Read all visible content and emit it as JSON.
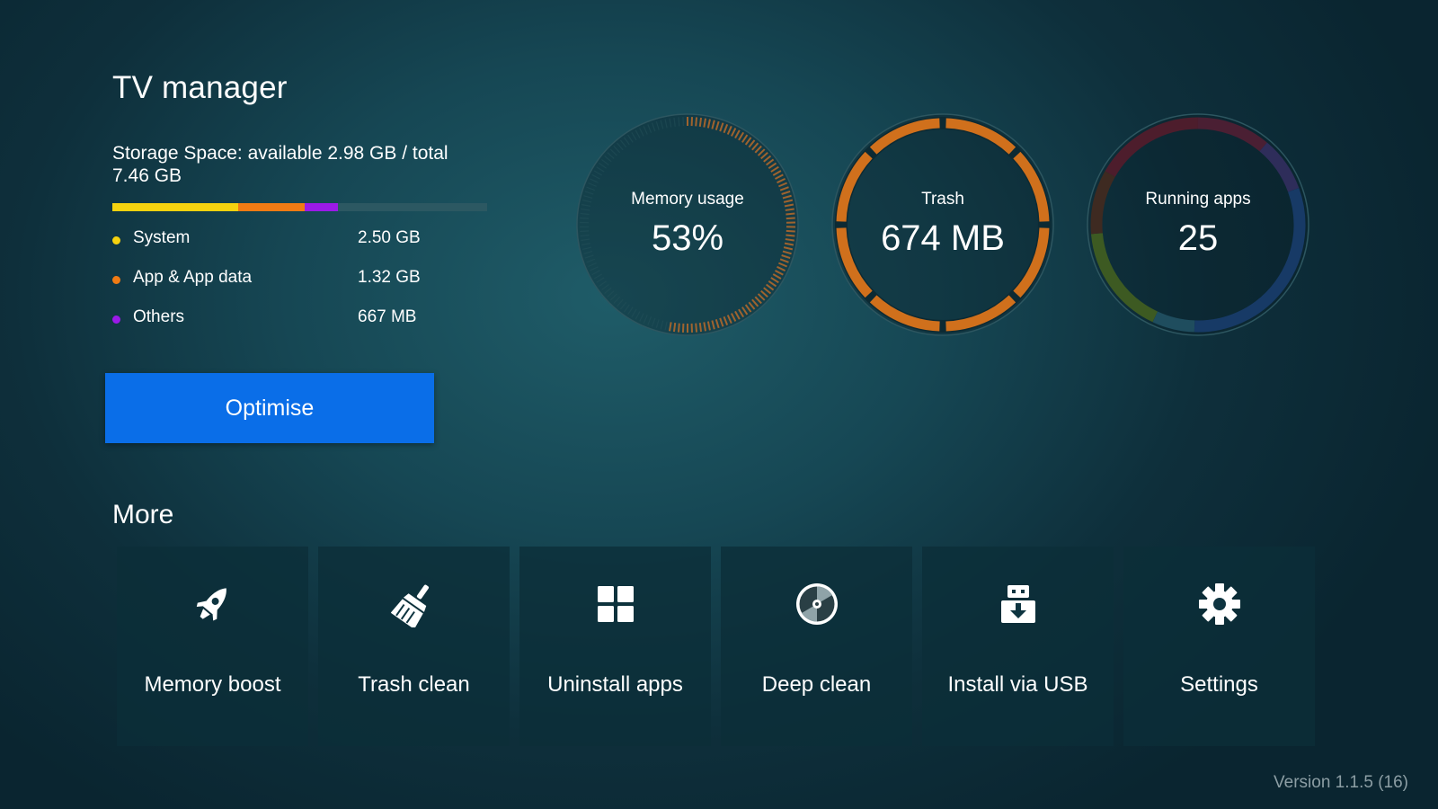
{
  "app": {
    "title": "TV manager",
    "version": "Version 1.1.5 (16)"
  },
  "storage": {
    "summary": "Storage Space: available 2.98 GB / total 7.46 GB",
    "available_gb": 2.98,
    "total_gb": 7.46,
    "categories": [
      {
        "label": "System",
        "value": "2.50 GB",
        "amount_gb": 2.5,
        "color": "#f5d20f"
      },
      {
        "label": "App & App data",
        "value": "1.32 GB",
        "amount_gb": 1.32,
        "color": "#f07b14"
      },
      {
        "label": "Others",
        "value": "667 MB",
        "amount_gb": 0.667,
        "color": "#9b1ae8"
      }
    ],
    "track_color": "#2c5862"
  },
  "optimise_button": {
    "label": "Optimise",
    "color": "#0a6ee8"
  },
  "gauges": [
    {
      "label": "Memory usage",
      "value": "53%",
      "fraction": 0.53,
      "style": "ticks",
      "color": "#b86a2a"
    },
    {
      "label": "Trash",
      "value": "674 MB",
      "style": "segmented",
      "color": "#d0701c"
    },
    {
      "label": "Running apps",
      "value": "25",
      "style": "multicolor"
    }
  ],
  "more": {
    "heading": "More",
    "tiles": [
      {
        "label": "Memory boost",
        "icon": "rocket-icon"
      },
      {
        "label": "Trash clean",
        "icon": "broom-icon"
      },
      {
        "label": "Uninstall apps",
        "icon": "grid-icon"
      },
      {
        "label": "Deep clean",
        "icon": "disc-icon"
      },
      {
        "label": "Install via USB",
        "icon": "usb-install-icon"
      },
      {
        "label": "Settings",
        "icon": "gear-icon"
      }
    ]
  }
}
